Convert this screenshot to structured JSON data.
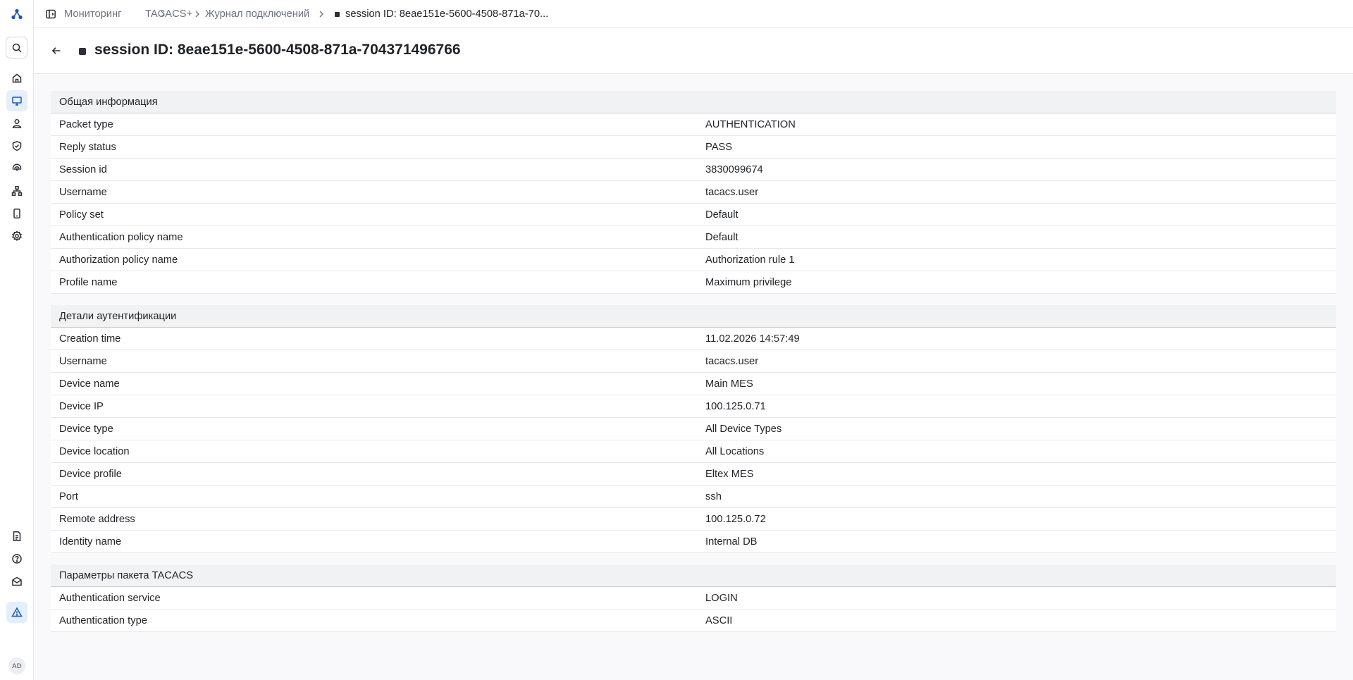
{
  "breadcrumb": {
    "items": [
      "Мониторинг",
      "TACACS+",
      "Журнал подключений"
    ],
    "current": "session ID: 8eae151e-5600-4508-871a-70..."
  },
  "page": {
    "title": "session ID: 8eae151e-5600-4508-871a-704371496766"
  },
  "sections": [
    {
      "title": "Общая информация",
      "rows": [
        {
          "key": "Packet type",
          "value": "AUTHENTICATION"
        },
        {
          "key": "Reply status",
          "value": "PASS"
        },
        {
          "key": "Session id",
          "value": "3830099674"
        },
        {
          "key": "Username",
          "value": "tacacs.user"
        },
        {
          "key": "Policy set",
          "value": "Default"
        },
        {
          "key": "Authentication policy name",
          "value": "Default"
        },
        {
          "key": "Authorization policy name",
          "value": "Authorization rule 1"
        },
        {
          "key": "Profile name",
          "value": "Maximum privilege"
        }
      ]
    },
    {
      "title": "Детали аутентификации",
      "rows": [
        {
          "key": "Creation time",
          "value": "11.02.2026 14:57:49"
        },
        {
          "key": "Username",
          "value": "tacacs.user"
        },
        {
          "key": "Device name",
          "value": "Main MES"
        },
        {
          "key": "Device IP",
          "value": "100.125.0.71"
        },
        {
          "key": "Device type",
          "value": "All Device Types"
        },
        {
          "key": "Device location",
          "value": "All Locations"
        },
        {
          "key": "Device profile",
          "value": "Eltex MES"
        },
        {
          "key": "Port",
          "value": "ssh"
        },
        {
          "key": "Remote address",
          "value": "100.125.0.72"
        },
        {
          "key": "Identity name",
          "value": "Internal DB"
        }
      ]
    },
    {
      "title": "Параметры пакета TACACS",
      "rows": [
        {
          "key": "Authentication service",
          "value": "LOGIN"
        },
        {
          "key": "Authentication type",
          "value": "ASCII"
        }
      ]
    }
  ],
  "user": {
    "initials": "AD"
  },
  "icons": {
    "logo": "network-logo-icon",
    "search": "search-icon",
    "home": "home-icon",
    "monitor": "monitor-icon",
    "user": "user-icon",
    "shield": "shield-check-icon",
    "broadcast": "broadcast-icon",
    "topology": "topology-icon",
    "device": "device-icon",
    "settings": "gear-icon",
    "docs": "document-icon",
    "help": "help-icon",
    "mail": "mail-icon",
    "alert": "alert-triangle-icon"
  },
  "colors": {
    "accent": "#1a56b4",
    "active_bg": "#e6eefa"
  }
}
